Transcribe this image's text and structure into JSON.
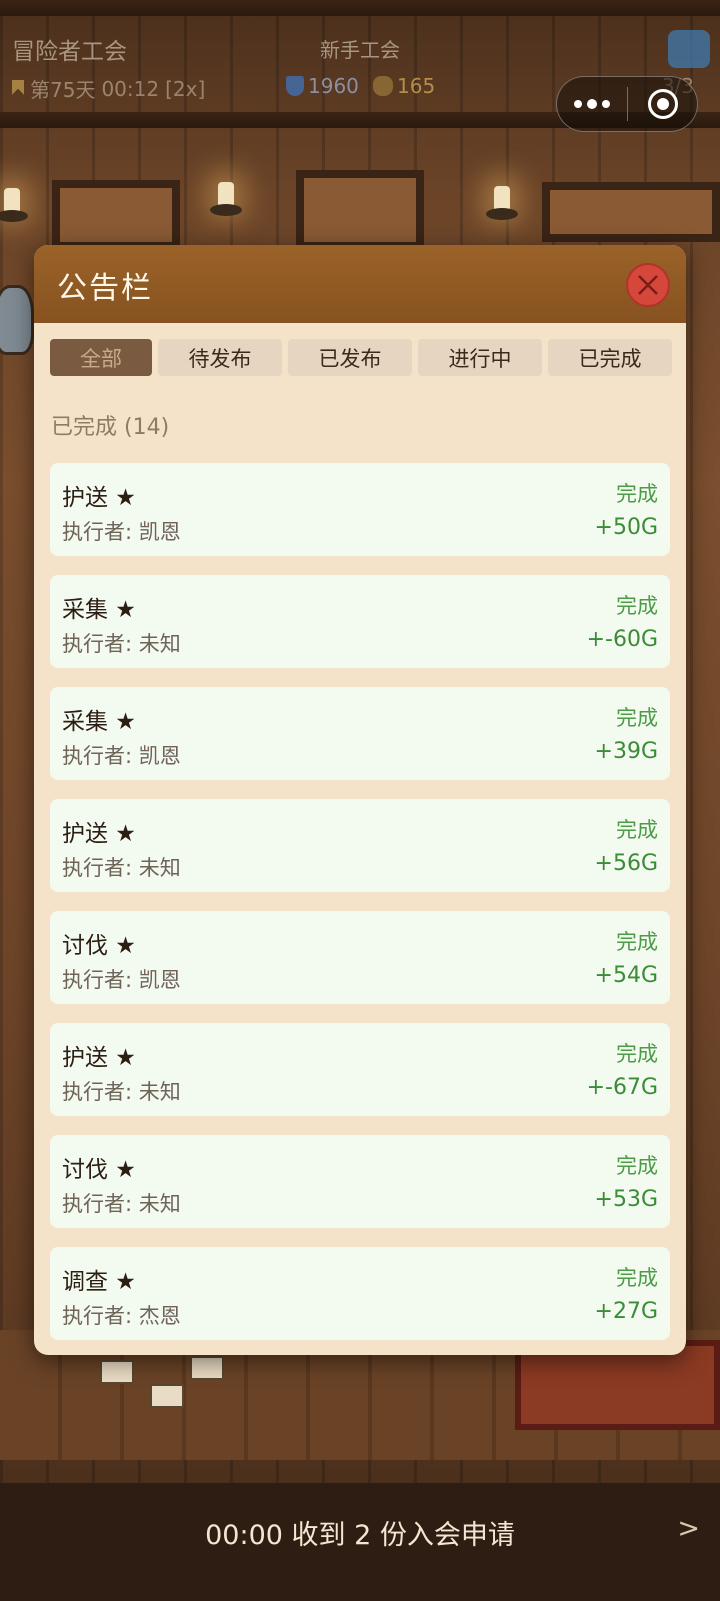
{
  "hud": {
    "guild_name": "冒险者工会",
    "guild_rank": "新手工会",
    "day": "第75天",
    "clock": "00:12",
    "speed": "[2x]",
    "defense": "1960",
    "gold": "165",
    "party_count": "3/3"
  },
  "bulletin": {
    "title": "公告栏",
    "tabs": [
      {
        "label": "全部",
        "active": true
      },
      {
        "label": "待发布",
        "active": false
      },
      {
        "label": "已发布",
        "active": false
      },
      {
        "label": "进行中",
        "active": false
      },
      {
        "label": "已完成",
        "active": false
      }
    ],
    "section_label": "已完成 (14)",
    "tasks": [
      {
        "name": "护送 ★",
        "executor": "执行者: 凯恩",
        "status": "完成",
        "reward": "+50G"
      },
      {
        "name": "采集 ★",
        "executor": "执行者: 未知",
        "status": "完成",
        "reward": "+-60G"
      },
      {
        "name": "采集 ★",
        "executor": "执行者: 凯恩",
        "status": "完成",
        "reward": "+39G"
      },
      {
        "name": "护送 ★",
        "executor": "执行者: 未知",
        "status": "完成",
        "reward": "+56G"
      },
      {
        "name": "讨伐 ★",
        "executor": "执行者: 凯恩",
        "status": "完成",
        "reward": "+54G"
      },
      {
        "name": "护送 ★",
        "executor": "执行者: 未知",
        "status": "完成",
        "reward": "+-67G"
      },
      {
        "name": "讨伐 ★",
        "executor": "执行者: 未知",
        "status": "完成",
        "reward": "+53G"
      },
      {
        "name": "调查 ★",
        "executor": "执行者: 杰恩",
        "status": "完成",
        "reward": "+27G"
      }
    ]
  },
  "notification": {
    "text": "00:00 收到 2 份入会申请",
    "arrow": ">"
  },
  "colors": {
    "header": "#8d5723",
    "panel": "#f5e3c9",
    "card": "#f3fbf1",
    "status_green": "#4d9a47",
    "close_red": "#d4473a"
  }
}
